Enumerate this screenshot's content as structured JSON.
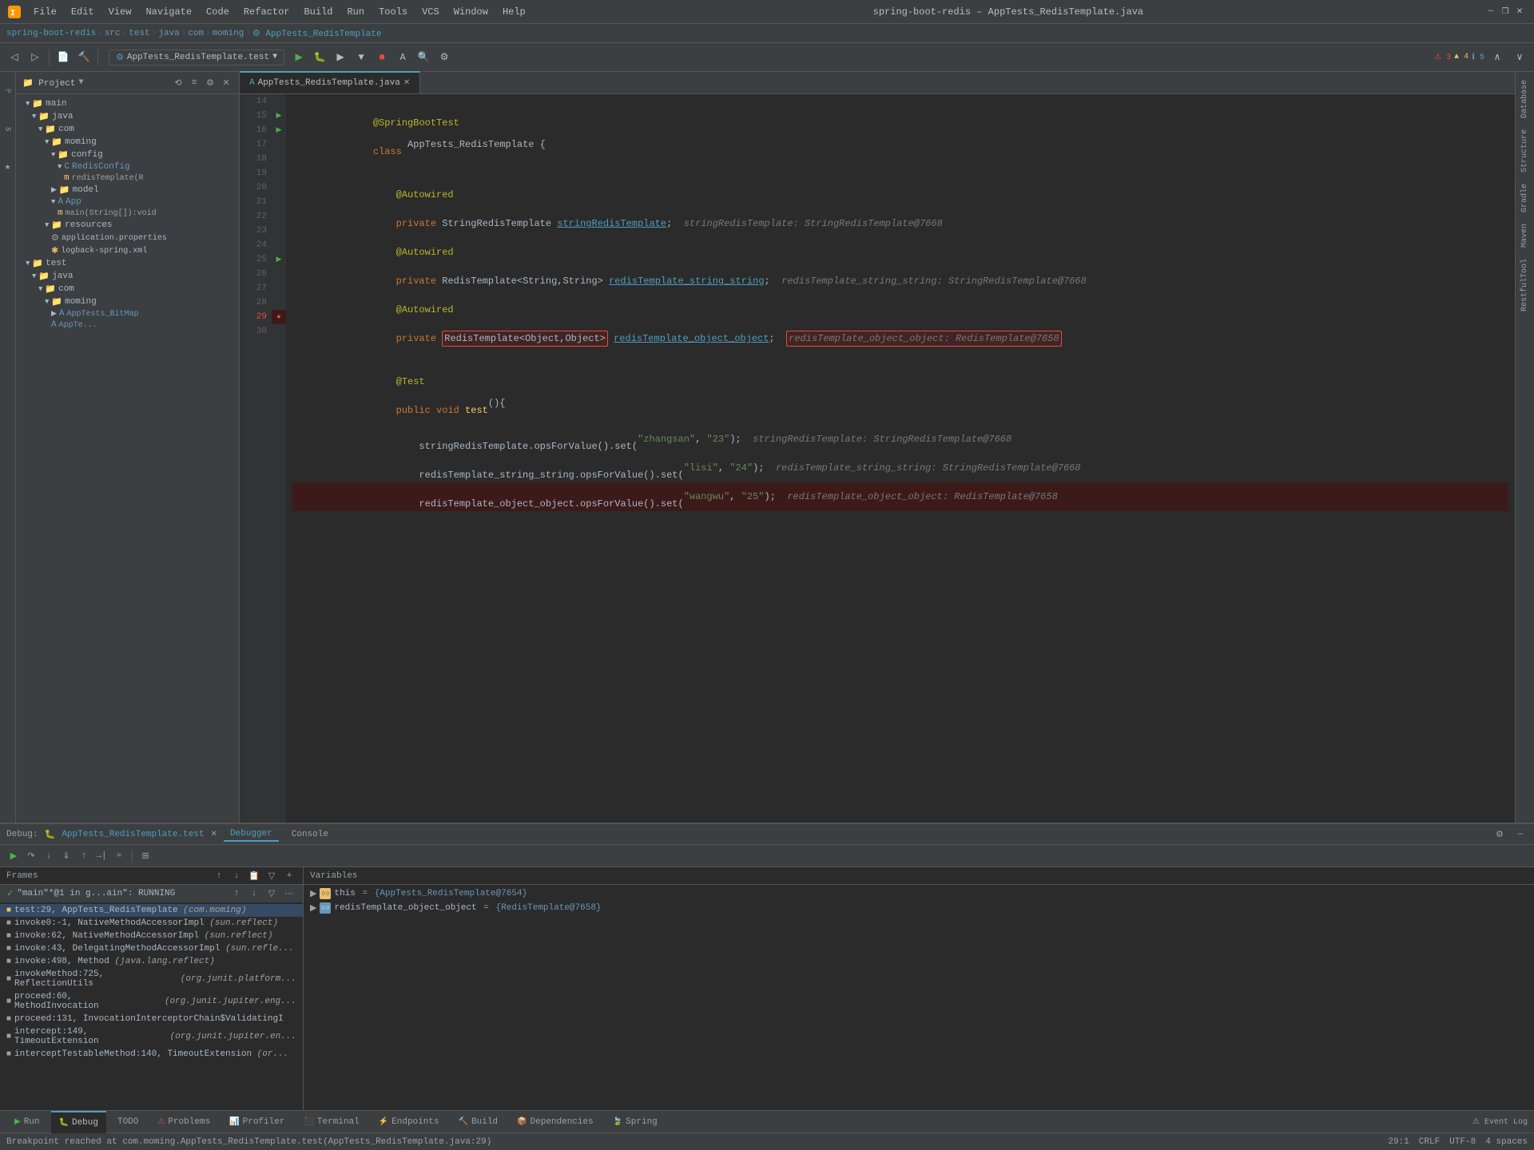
{
  "titlebar": {
    "title": "spring-boot-redis – AppTests_RedisTemplate.java",
    "menu": [
      "File",
      "Edit",
      "View",
      "Navigate",
      "Code",
      "Refactor",
      "Build",
      "Run",
      "Tools",
      "VCS",
      "Window",
      "Help"
    ]
  },
  "breadcrumb": {
    "parts": [
      "spring-boot-redis",
      "src",
      "test",
      "java",
      "com",
      "moming",
      "AppTests_RedisTemplate"
    ]
  },
  "run_config": {
    "label": "AppTests_RedisTemplate.test"
  },
  "project": {
    "title": "Project",
    "tree": [
      {
        "indent": 0,
        "type": "folder",
        "label": "main",
        "expanded": true
      },
      {
        "indent": 1,
        "type": "folder",
        "label": "java",
        "expanded": true
      },
      {
        "indent": 2,
        "type": "folder",
        "label": "com",
        "expanded": true
      },
      {
        "indent": 3,
        "type": "folder",
        "label": "moming",
        "expanded": true
      },
      {
        "indent": 4,
        "type": "folder",
        "label": "config",
        "expanded": true
      },
      {
        "indent": 5,
        "type": "class",
        "label": "RedisConfig",
        "expanded": true
      },
      {
        "indent": 6,
        "type": "method",
        "label": "redisTemplate(R"
      },
      {
        "indent": 4,
        "type": "folder",
        "label": "model"
      },
      {
        "indent": 4,
        "type": "class",
        "label": "App"
      },
      {
        "indent": 5,
        "type": "method",
        "label": "main(String[]):void"
      },
      {
        "indent": 3,
        "type": "folder",
        "label": "resources",
        "expanded": true
      },
      {
        "indent": 4,
        "type": "props",
        "label": "application.properties"
      },
      {
        "indent": 4,
        "type": "xml",
        "label": "logback-spring.xml"
      },
      {
        "indent": 2,
        "type": "folder",
        "label": "test",
        "expanded": true
      },
      {
        "indent": 3,
        "type": "folder",
        "label": "java",
        "expanded": true
      },
      {
        "indent": 4,
        "type": "folder",
        "label": "com",
        "expanded": true
      },
      {
        "indent": 5,
        "type": "folder",
        "label": "moming",
        "expanded": true
      },
      {
        "indent": 6,
        "type": "class",
        "label": "AppTests_BitMap"
      },
      {
        "indent": 6,
        "type": "class",
        "label": "AppTe..."
      }
    ]
  },
  "editor": {
    "filename": "AppTests_RedisTemplate.java",
    "lines": [
      {
        "num": 14,
        "content": "",
        "gutter": ""
      },
      {
        "num": 15,
        "content": "    @SpringBootTest",
        "gutter": "run",
        "type": "annotation"
      },
      {
        "num": 16,
        "content": "    class AppTests_RedisTemplate {",
        "gutter": "run",
        "type": "normal"
      },
      {
        "num": 17,
        "content": "",
        "gutter": ""
      },
      {
        "num": 18,
        "content": "        @Autowired",
        "gutter": "",
        "type": "annotation"
      },
      {
        "num": 19,
        "content": "        private StringRedisTemplate stringRedisTemplate;",
        "gutter": "",
        "type": "normal",
        "hint": "        stringRedisTemplate: StringRedisTemplate@7668"
      },
      {
        "num": 20,
        "content": "        @Autowired",
        "gutter": "",
        "type": "annotation"
      },
      {
        "num": 21,
        "content": "        private RedisTemplate<String,String> redisTemplate_string_string;",
        "gutter": "",
        "type": "normal",
        "hint": "  redisTemplate_string_string: StringRedisTemplate@7668"
      },
      {
        "num": 22,
        "content": "        @Autowired",
        "gutter": "",
        "type": "annotation"
      },
      {
        "num": 23,
        "content": "        private RedisTemplate<Object,Object> redisTemplate_object_object;",
        "gutter": "",
        "type": "normal",
        "hint": "  redisTemplate_object_object: RedisTemplate@7658",
        "highlight_type": true,
        "highlight_hint": true
      },
      {
        "num": 24,
        "content": "",
        "gutter": ""
      },
      {
        "num": 25,
        "content": "        @Test",
        "gutter": "run",
        "type": "annotation"
      },
      {
        "num": 26,
        "content": "        public void test(){",
        "gutter": "",
        "type": "normal"
      },
      {
        "num": 27,
        "content": "            stringRedisTemplate.opsForValue().set(\"zhangsan\", \"23\");",
        "gutter": "",
        "type": "normal",
        "hint": "  stringRedisTemplate: StringRedisTemplate@7668"
      },
      {
        "num": 28,
        "content": "            redisTemplate_string_string.opsForValue().set(\"lisi\", \"24\");",
        "gutter": "",
        "type": "normal",
        "hint": "  redisTemplate_string_string: StringRedisTemplate@7668"
      },
      {
        "num": 29,
        "content": "            redisTemplate_object_object.opsForValue().set(\"wangwu\", \"25\");",
        "gutter": "bp",
        "type": "breakpoint",
        "hint": "  redisTemplate_object_object: RedisTemplate@7658"
      },
      {
        "num": 30,
        "content": "",
        "gutter": ""
      }
    ],
    "errors": "3",
    "warnings": "4",
    "infos": "5"
  },
  "debug": {
    "label": "Debug:",
    "config_name": "AppTests_RedisTemplate.test",
    "tabs": [
      "Debugger",
      "Console"
    ],
    "frames": {
      "title": "Frames",
      "thread_name": "\"main\"*@1 in g...ain\": RUNNING",
      "items": [
        {
          "label": "test:29, AppTests_RedisTemplate",
          "package": "(com.moming)",
          "selected": true
        },
        {
          "label": "invoke0:-1, NativeMethodAccessorImpl",
          "package": "(sun.reflect)"
        },
        {
          "label": "invoke:62, NativeMethodAccessorImpl",
          "package": "(sun.reflect)"
        },
        {
          "label": "invoke:43, DelegatingMethodAccessorImpl",
          "package": "(sun.refle..."
        },
        {
          "label": "invoke:498, Method",
          "package": "(java.lang.reflect)"
        },
        {
          "label": "invokeMethod:725, ReflectionUtils",
          "package": "(org.junit.platform..."
        },
        {
          "label": "proceed:60, MethodInvocation",
          "package": "(org.junit.jupiter.eng..."
        },
        {
          "label": "proceed:131, InvocationInterceptorChain$ValidatingI"
        },
        {
          "label": "intercept:149, TimeoutExtension",
          "package": "(org.junit.jupiter.en..."
        },
        {
          "label": "interceptTestableMethod:140, TimeoutExtension",
          "package": "(or..."
        }
      ]
    },
    "variables": {
      "title": "Variables",
      "items": [
        {
          "name": "this",
          "value": "{AppTests_RedisTemplate@7654}",
          "type": "obj",
          "expanded": false
        },
        {
          "name": "redisTemplate_object_object",
          "value": "{RedisTemplate@7658}",
          "type": "obj",
          "expanded": false
        }
      ]
    }
  },
  "bottom_tabs": [
    "Run",
    "Debug",
    "TODO",
    "Problems",
    "Profiler",
    "Terminal",
    "Endpoints",
    "Build",
    "Dependencies",
    "Spring"
  ],
  "active_bottom_tab": "Debug",
  "status": {
    "message": "Breakpoint reached at com.moming.AppTests_RedisTemplate.test(AppTests_RedisTemplate.java:29)",
    "position": "29:1",
    "encoding": "CRLF",
    "charset": "UTF-8",
    "indent": "4 spaces",
    "event_log": "Event Log"
  },
  "right_panels": [
    "Database",
    "Structure",
    "Gradle",
    "Maven",
    "RestfulTool"
  ]
}
